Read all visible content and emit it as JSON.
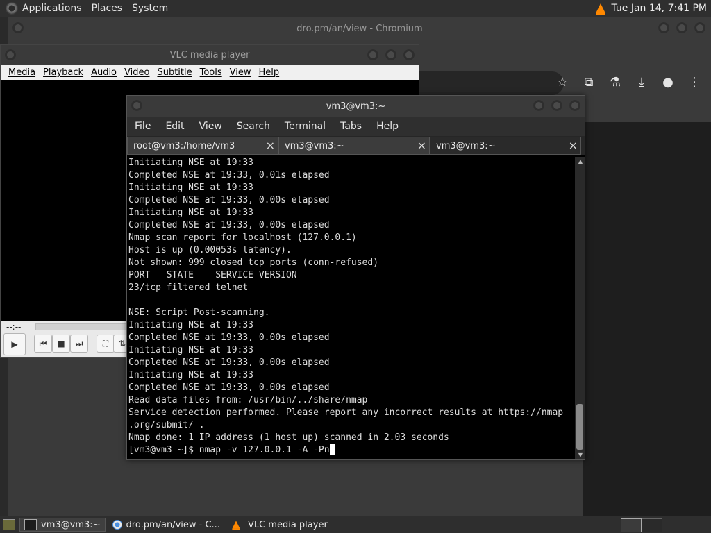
{
  "top_panel": {
    "menus": [
      "Applications",
      "Places",
      "System"
    ],
    "clock": "Tue Jan 14,  7:41 PM"
  },
  "chromium": {
    "title": "dro.pm/an/view - Chromium",
    "toolbar_icons": [
      "star-icon",
      "extension-icon",
      "labs-icon",
      "download-icon",
      "profile-icon",
      "menu-icon"
    ]
  },
  "vlc": {
    "title": "VLC media player",
    "menu": [
      "Media",
      "Playback",
      "Audio",
      "Video",
      "Subtitle",
      "Tools",
      "View",
      "Help"
    ],
    "time": "--:--"
  },
  "terminal": {
    "title": "vm3@vm3:~",
    "menu": [
      "File",
      "Edit",
      "View",
      "Search",
      "Terminal",
      "Tabs",
      "Help"
    ],
    "tabs": [
      "root@vm3:/home/vm3",
      "vm3@vm3:~",
      "vm3@vm3:~"
    ],
    "active_tab": 2,
    "lines": [
      "Initiating NSE at 19:33",
      "Completed NSE at 19:33, 0.01s elapsed",
      "Initiating NSE at 19:33",
      "Completed NSE at 19:33, 0.00s elapsed",
      "Initiating NSE at 19:33",
      "Completed NSE at 19:33, 0.00s elapsed",
      "Nmap scan report for localhost (127.0.0.1)",
      "Host is up (0.00053s latency).",
      "Not shown: 999 closed tcp ports (conn-refused)",
      "PORT   STATE    SERVICE VERSION",
      "23/tcp filtered telnet",
      "",
      "NSE: Script Post-scanning.",
      "Initiating NSE at 19:33",
      "Completed NSE at 19:33, 0.00s elapsed",
      "Initiating NSE at 19:33",
      "Completed NSE at 19:33, 0.00s elapsed",
      "Initiating NSE at 19:33",
      "Completed NSE at 19:33, 0.00s elapsed",
      "Read data files from: /usr/bin/../share/nmap",
      "Service detection performed. Please report any incorrect results at https://nmap",
      ".org/submit/ .",
      "Nmap done: 1 IP address (1 host up) scanned in 2.03 seconds"
    ],
    "prompt": "[vm3@vm3 ~]$ nmap -v 127.0.0.1 -A -Pn"
  },
  "taskbar": {
    "items": [
      "vm3@vm3:~",
      "dro.pm/an/view - C...",
      "VLC media player"
    ]
  }
}
